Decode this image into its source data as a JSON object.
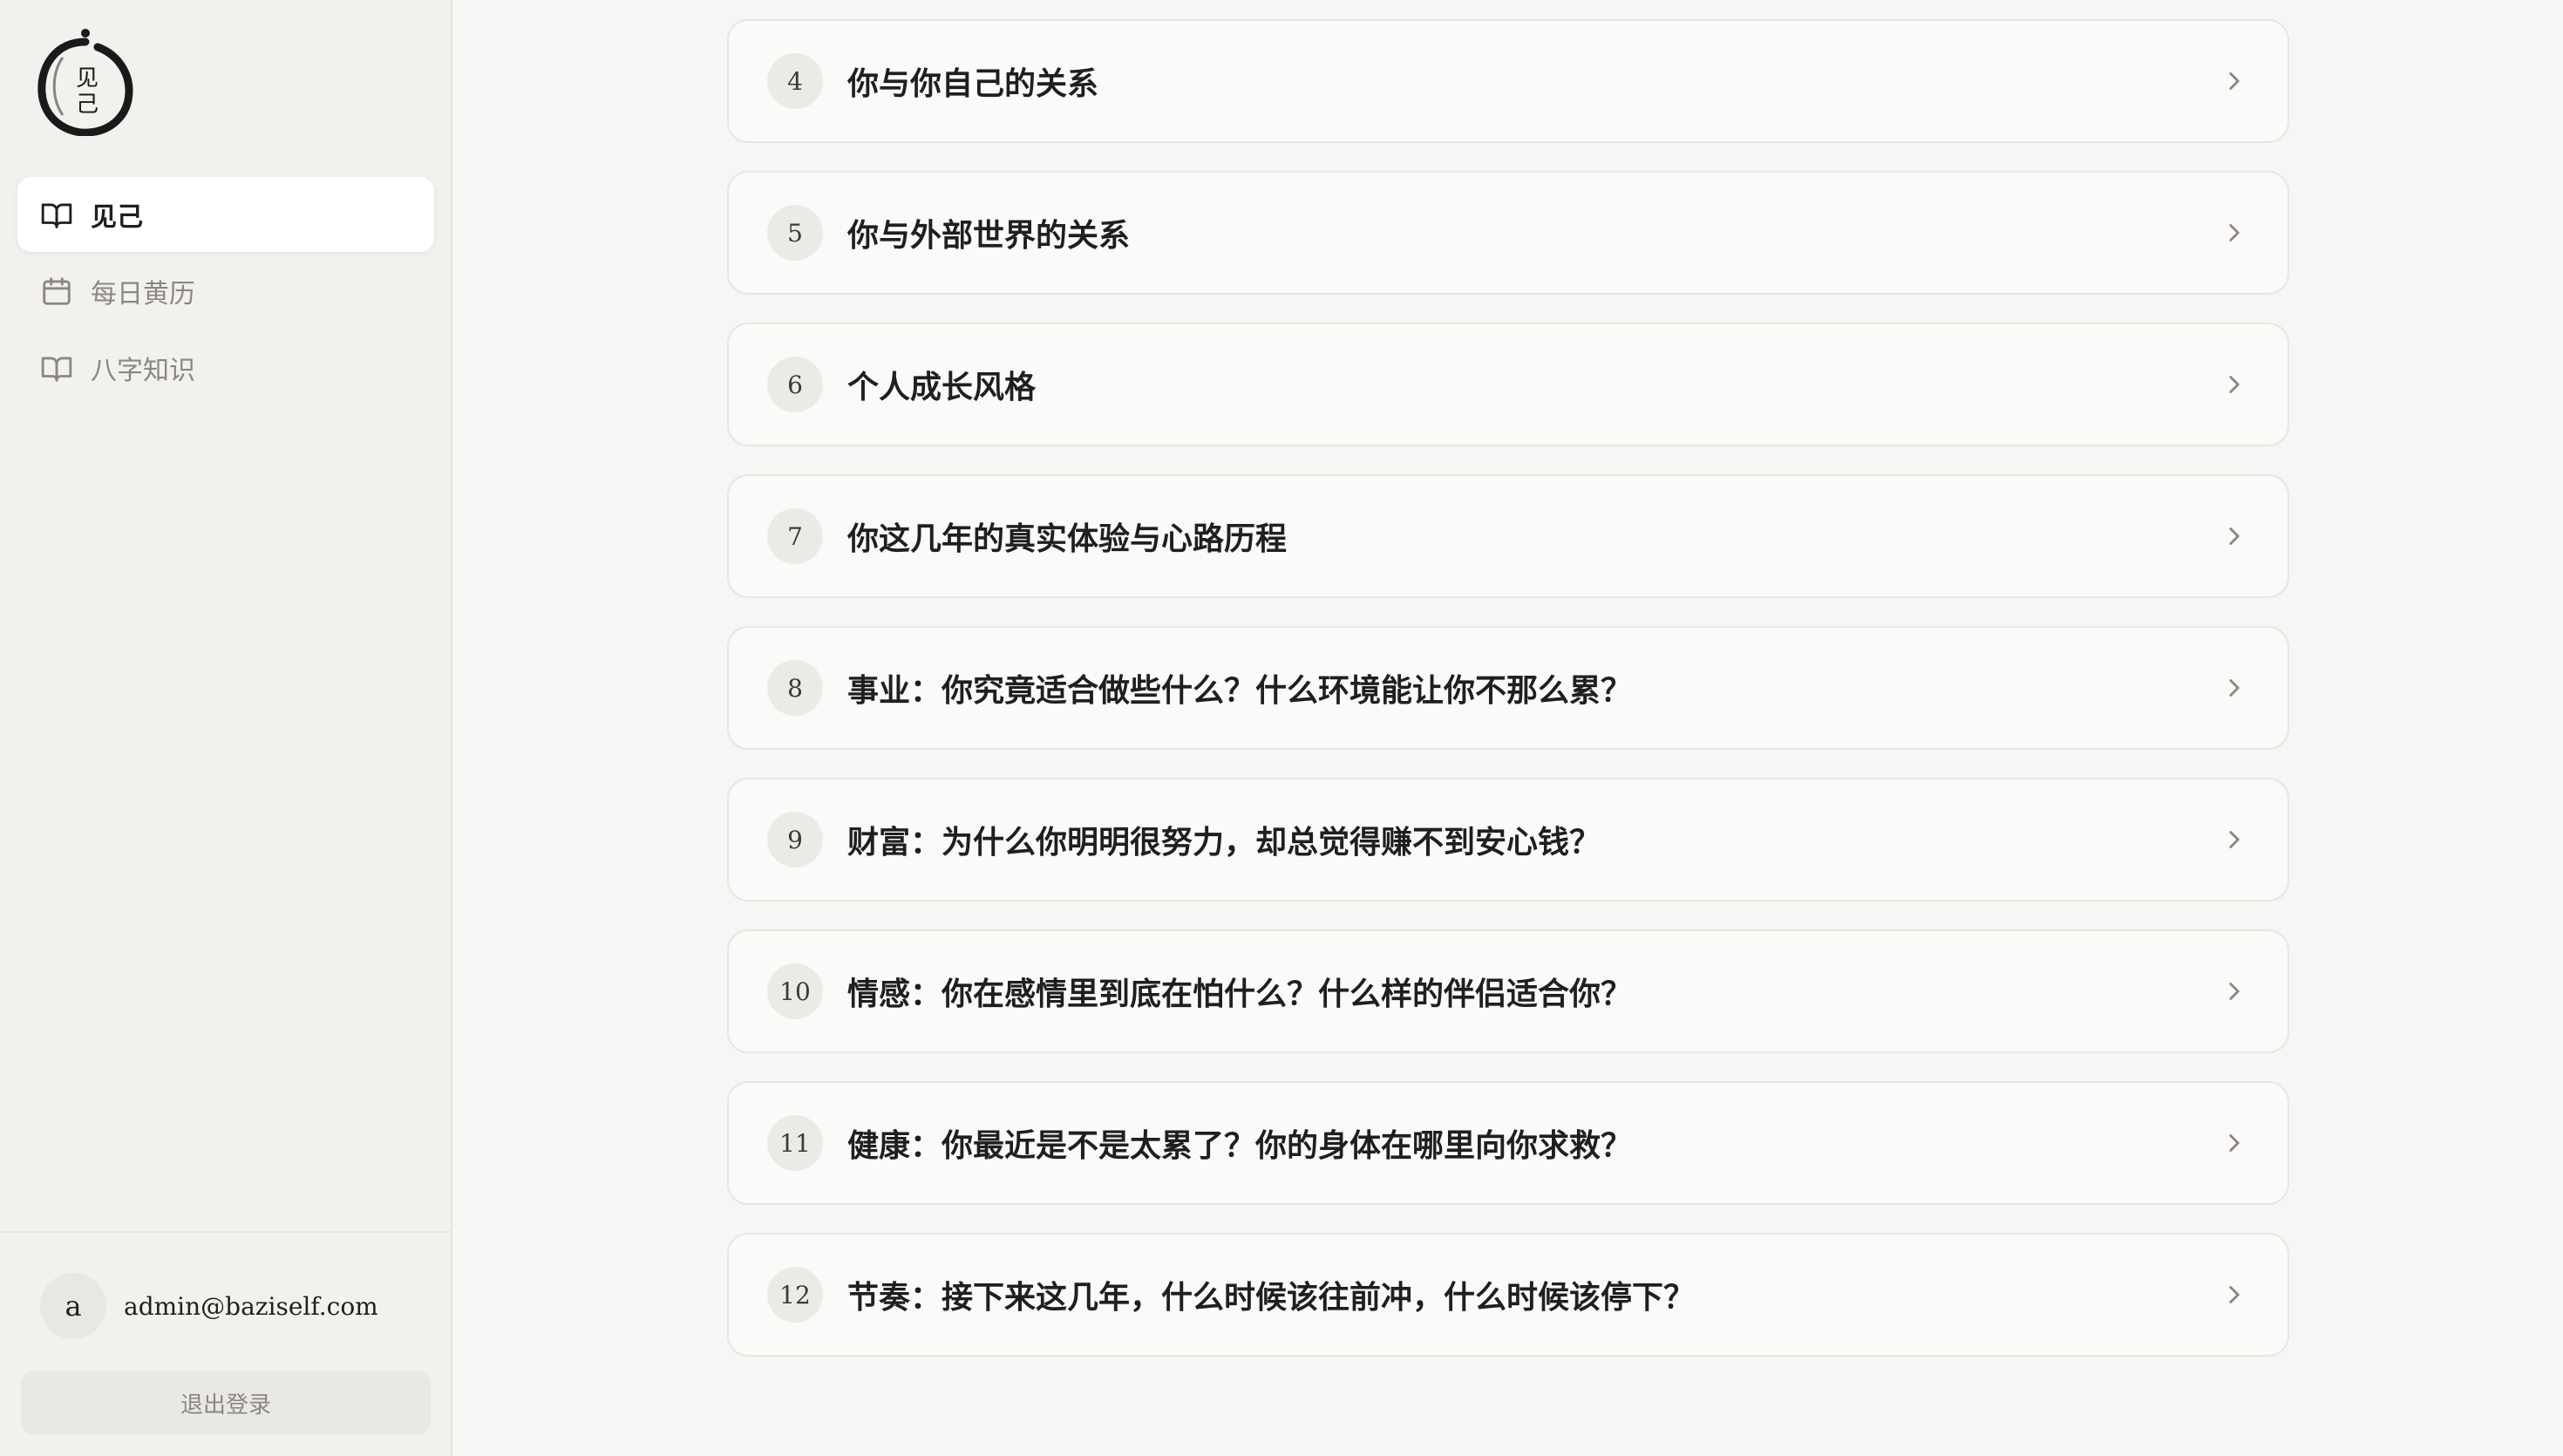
{
  "brand": {
    "logo_text_top": "见",
    "logo_text_bottom": "己"
  },
  "sidebar": {
    "items": [
      {
        "label": "见己",
        "icon": "book-open-icon",
        "active": true
      },
      {
        "label": "每日黄历",
        "icon": "calendar-icon",
        "active": false
      },
      {
        "label": "八字知识",
        "icon": "book-open-icon",
        "active": false
      }
    ]
  },
  "user": {
    "avatar_letter": "a",
    "email": "admin@baziself.com",
    "logout_label": "退出登录"
  },
  "sections": [
    {
      "number": "4",
      "title": "你与你自己的关系"
    },
    {
      "number": "5",
      "title": "你与外部世界的关系"
    },
    {
      "number": "6",
      "title": "个人成长风格"
    },
    {
      "number": "7",
      "title": "你这几年的真实体验与心路历程"
    },
    {
      "number": "8",
      "title": "事业：你究竟适合做些什么？什么环境能让你不那么累？"
    },
    {
      "number": "9",
      "title": "财富：为什么你明明很努力，却总觉得赚不到安心钱？"
    },
    {
      "number": "10",
      "title": "情感：你在感情里到底在怕什么？什么样的伴侣适合你？"
    },
    {
      "number": "11",
      "title": "健康：你最近是不是太累了？你的身体在哪里向你求救？"
    },
    {
      "number": "12",
      "title": "节奏：接下来这几年，什么时候该往前冲，什么时候该停下？"
    }
  ],
  "colors": {
    "page_bg": "#f7f6f4",
    "sidebar_bg": "#f2f1ee",
    "card_bg": "#fbfaf8",
    "text": "#1f1f1f",
    "muted": "#8a8783"
  }
}
